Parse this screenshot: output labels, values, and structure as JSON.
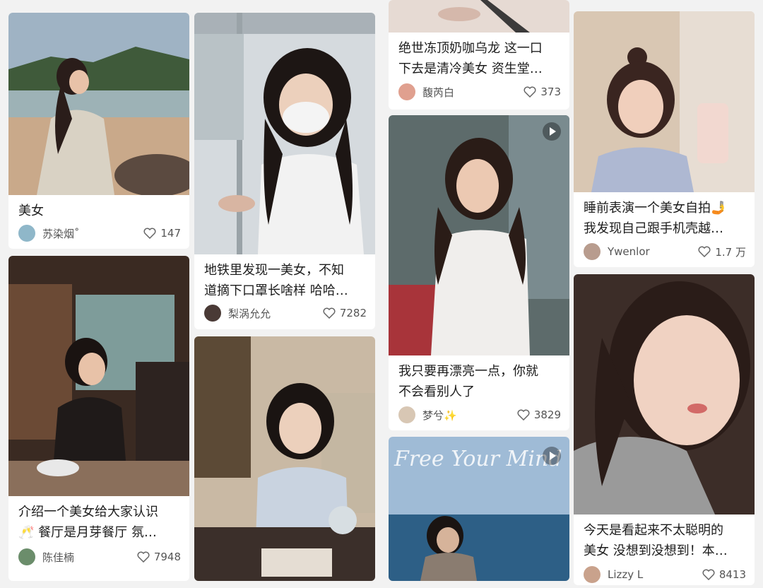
{
  "feed": {
    "cards": [
      {
        "title_lines": [
          "美女"
        ],
        "author": "苏染烟˚",
        "likes": "147"
      },
      {
        "title_lines": [
          "介绍一个美女给大家认识",
          "🥂 餐厅是月芽餐厅 氛…"
        ],
        "author": "陈佳楠",
        "likes": "7948"
      },
      {
        "title_lines": [
          "地铁里发现一美女，不知",
          "道摘下口罩长啥样 哈哈…"
        ],
        "author": "梨涡允允",
        "likes": "7282"
      },
      {
        "title_lines": [],
        "author": "",
        "likes": ""
      },
      {
        "title_lines": [
          "绝世冻顶奶咖乌龙 这一口",
          "下去是清冷美女 资生堂…"
        ],
        "author": "馥芮白",
        "likes": "373"
      },
      {
        "title_lines": [
          "我只要再漂亮一点，你就",
          "不会看别人了"
        ],
        "author": "梦兮✨",
        "likes": "3829"
      },
      {
        "title_lines": [],
        "author": "",
        "likes": "",
        "image_text": "Free Your Mind"
      },
      {
        "title_lines": [
          "睡前表演一个美女自拍🤳",
          "我发现自己跟手机壳越…"
        ],
        "author": "Ywenlor",
        "likes": "1.7 万"
      },
      {
        "title_lines": [
          "今天是看起来不太聪明的",
          "美女 没想到没想到！本…"
        ],
        "author": "Lizzy L",
        "likes": "8413"
      }
    ]
  },
  "icons": {
    "like": "heart-icon",
    "video": "play-icon"
  },
  "colors": {
    "background": "#f2f2f2",
    "card": "#ffffff",
    "text": "#1d1d1d",
    "meta": "#555555"
  }
}
